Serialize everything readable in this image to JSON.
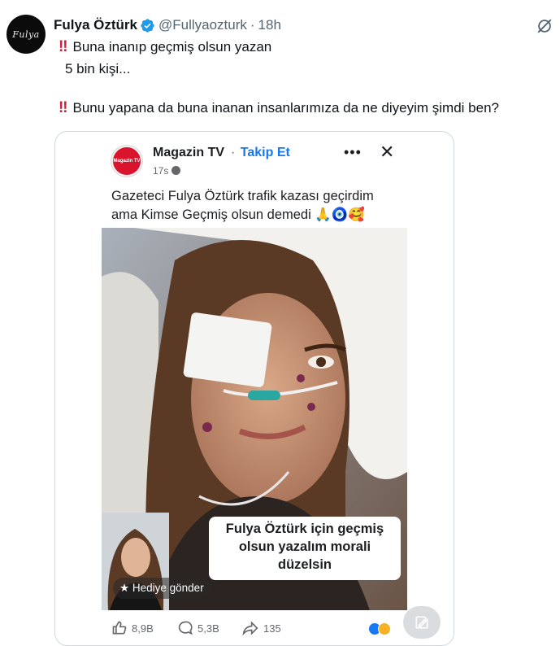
{
  "tweet": {
    "display_name": "Fulya Öztürk",
    "handle": "@Fullyaozturk",
    "separator": "·",
    "time": "18h",
    "avatar_text": "Fulya",
    "line1": "Buna inanıp geçmiş olsun yazan",
    "line2": "5 bin kişi...",
    "line3": "Bunu yapana da buna inanan insanlarımıza da ne diyeyim şimdi ben?",
    "bang": "‼",
    "verified_color": "#1d9bf0",
    "icons": [
      "verified-badge-icon",
      "grok-icon",
      "alt-text-icon"
    ]
  },
  "embedded": {
    "logo_text": "Magazin TV",
    "page_name": "Magazin TV",
    "dot": "·",
    "follow_label": "Takip Et",
    "post_time": "17s",
    "more_label": "•••",
    "close_label": "✕",
    "caption_line1": "Gazeteci Fulya Öztürk trafik kazası geçirdim",
    "caption_line2": "ama Kimse Geçmiş olsun demedi 🙏🧿🥰",
    "overlay_line1": "Fulya Öztürk için geçmiş",
    "overlay_line2": "olsun yazalım morali",
    "overlay_line3": "düzelsin",
    "gift_label": "Hediye gönder",
    "likes": "8,9B",
    "comments": "5,3B",
    "shares": "135",
    "accent": "#1877f2",
    "brand": "#d9142c"
  }
}
